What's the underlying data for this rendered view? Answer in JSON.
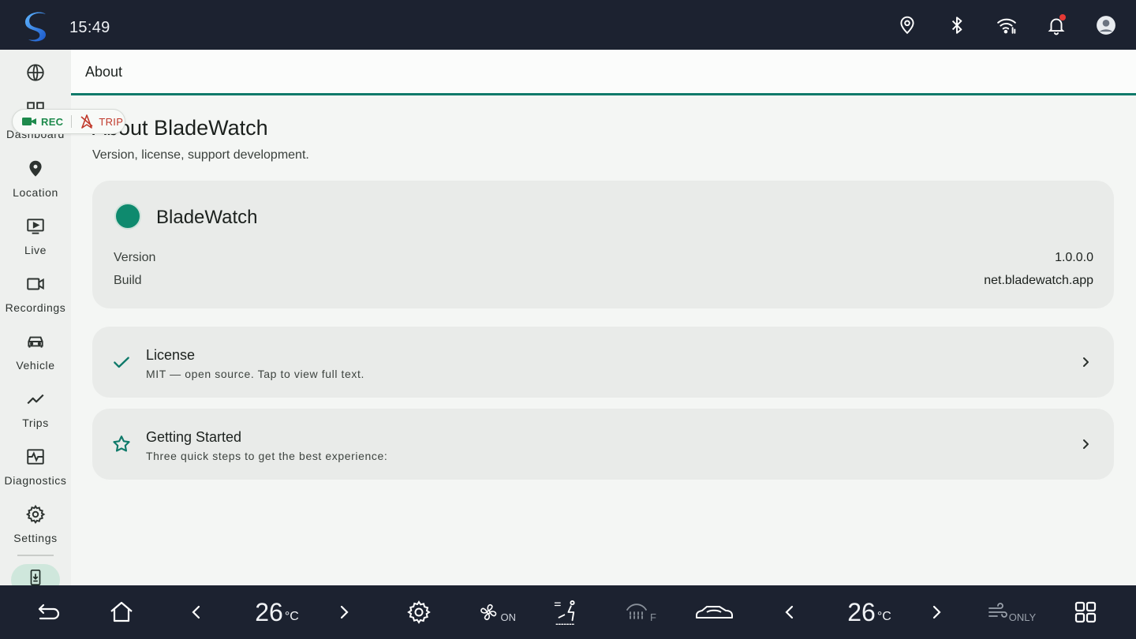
{
  "status_bar": {
    "time": "15:49",
    "icons": [
      "location-pin-icon",
      "bluetooth-icon",
      "wifi-icon",
      "bell-icon",
      "account-icon"
    ]
  },
  "sidebar": {
    "items": [
      {
        "label": "",
        "icon": "globe-icon"
      },
      {
        "label": "Dashboard",
        "icon": "dashboard-icon"
      },
      {
        "label": "Location",
        "icon": "location-icon"
      },
      {
        "label": "Live",
        "icon": "live-icon"
      },
      {
        "label": "Recordings",
        "icon": "video-camera-icon"
      },
      {
        "label": "Vehicle",
        "icon": "car-icon"
      },
      {
        "label": "Trips",
        "icon": "trend-icon"
      },
      {
        "label": "Diagnostics",
        "icon": "diagnostics-icon"
      },
      {
        "label": "Settings",
        "icon": "gear-icon"
      }
    ],
    "active_icon": "download-phone-icon"
  },
  "chip": {
    "rec": "REC",
    "trip": "TRIP"
  },
  "header": {
    "title": "About"
  },
  "content": {
    "title": "About BladeWatch",
    "subtitle": "Version, license, support development.",
    "app_card": {
      "name": "BladeWatch",
      "accent": "#0e8a6e",
      "rows": [
        {
          "label": "Version",
          "value": "1.0.0.0"
        },
        {
          "label": "Build",
          "value": "net.bladewatch.app"
        }
      ]
    },
    "license": {
      "title": "License",
      "desc": "MIT — open source. Tap to view full text."
    },
    "getting_started": {
      "title": "Getting Started",
      "desc": "Three quick steps to get the best experience:"
    }
  },
  "bottom_bar": {
    "left_temp": "26",
    "right_temp": "26",
    "unit": "°C",
    "fan_state": "ON",
    "defrost_label": "F",
    "ac_mode": "ONLY"
  },
  "colors": {
    "accent": "#0f7a6a",
    "bar_bg": "#1c2230",
    "rec": "#1e8a4c",
    "trip": "#c0392b"
  }
}
